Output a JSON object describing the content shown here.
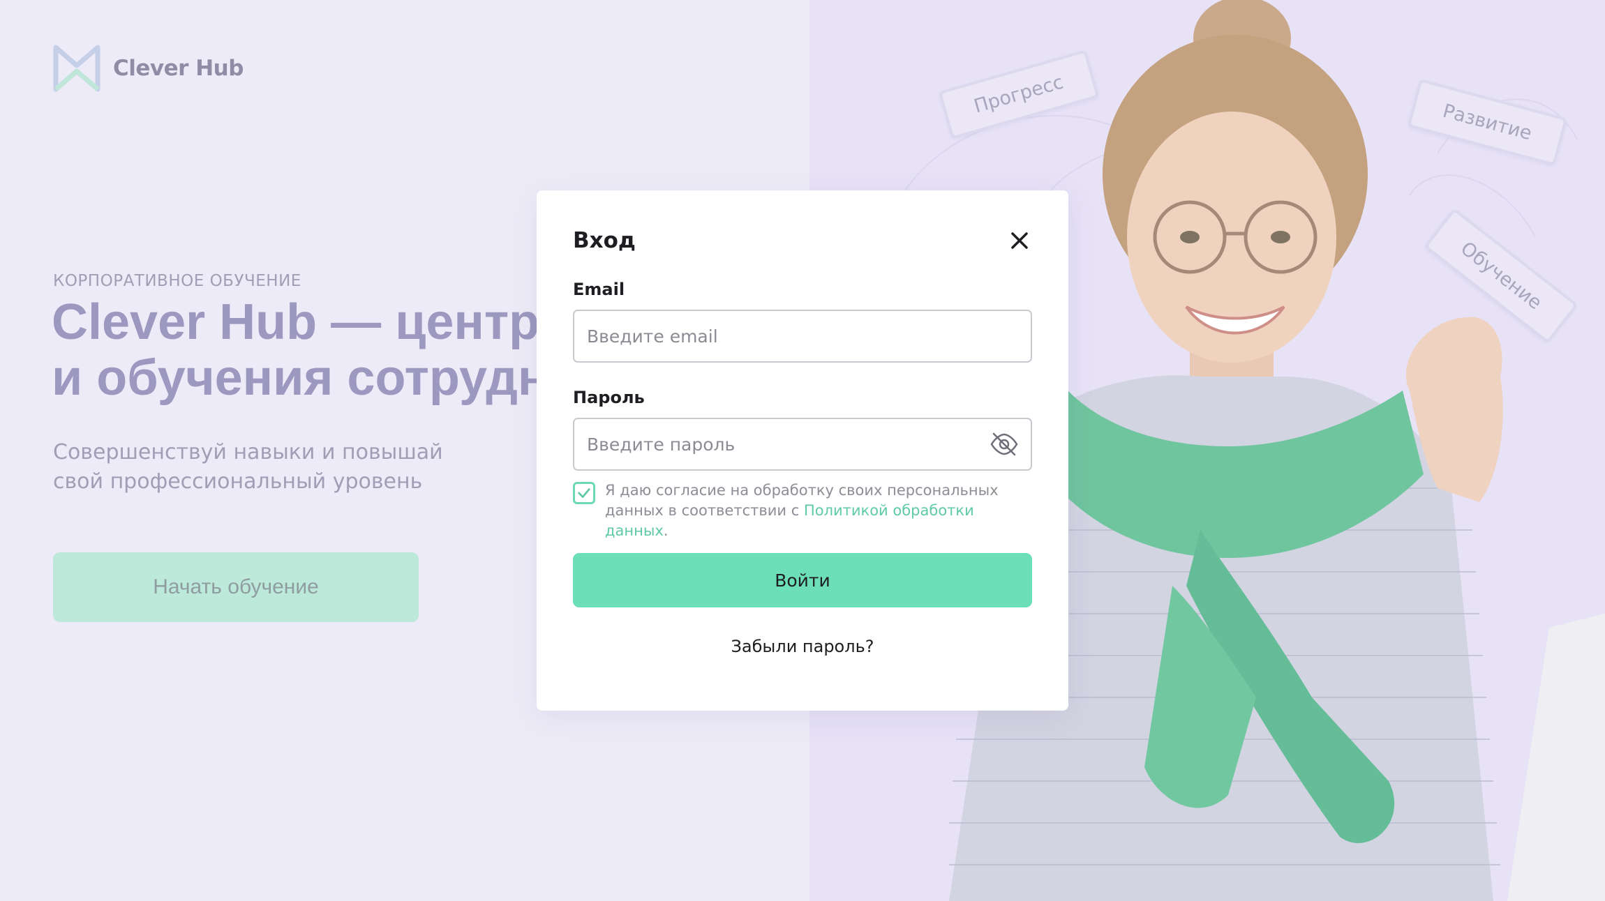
{
  "brand": {
    "name": "Clever Hub",
    "logo_icon": "clever-hub-logo-icon"
  },
  "hero": {
    "eyebrow": "КОРПОРАТИВНОЕ ОБУЧЕНИЕ",
    "title": "Clever Hub — центр\nи обучения сотрудн",
    "subtitle": "Совершенствуй навыки и повышай\nсвой профессиональный уровень",
    "cta_label": "Начать обучение"
  },
  "illustration": {
    "tags": [
      "Прогресс",
      "Развитие",
      "Обучение"
    ]
  },
  "login_modal": {
    "title": "Вход",
    "close_icon": "close-icon",
    "email": {
      "label": "Email",
      "placeholder": "Введите email",
      "value": ""
    },
    "password": {
      "label": "Пароль",
      "placeholder": "Введите пароль",
      "value": "",
      "toggle_icon": "eye-off-icon"
    },
    "consent": {
      "checked": true,
      "text": "Я даю согласие на обработку своих персональных данных в соответствии с ",
      "link_text": "Политикой обработки данных",
      "suffix": "."
    },
    "submit_label": "Войти",
    "forgot_label": "Забыли пароль?"
  },
  "colors": {
    "accent": "#6ddfb8",
    "link": "#5fcaa6",
    "background": "#eeebf8",
    "hero_title": "#9c98bf"
  }
}
